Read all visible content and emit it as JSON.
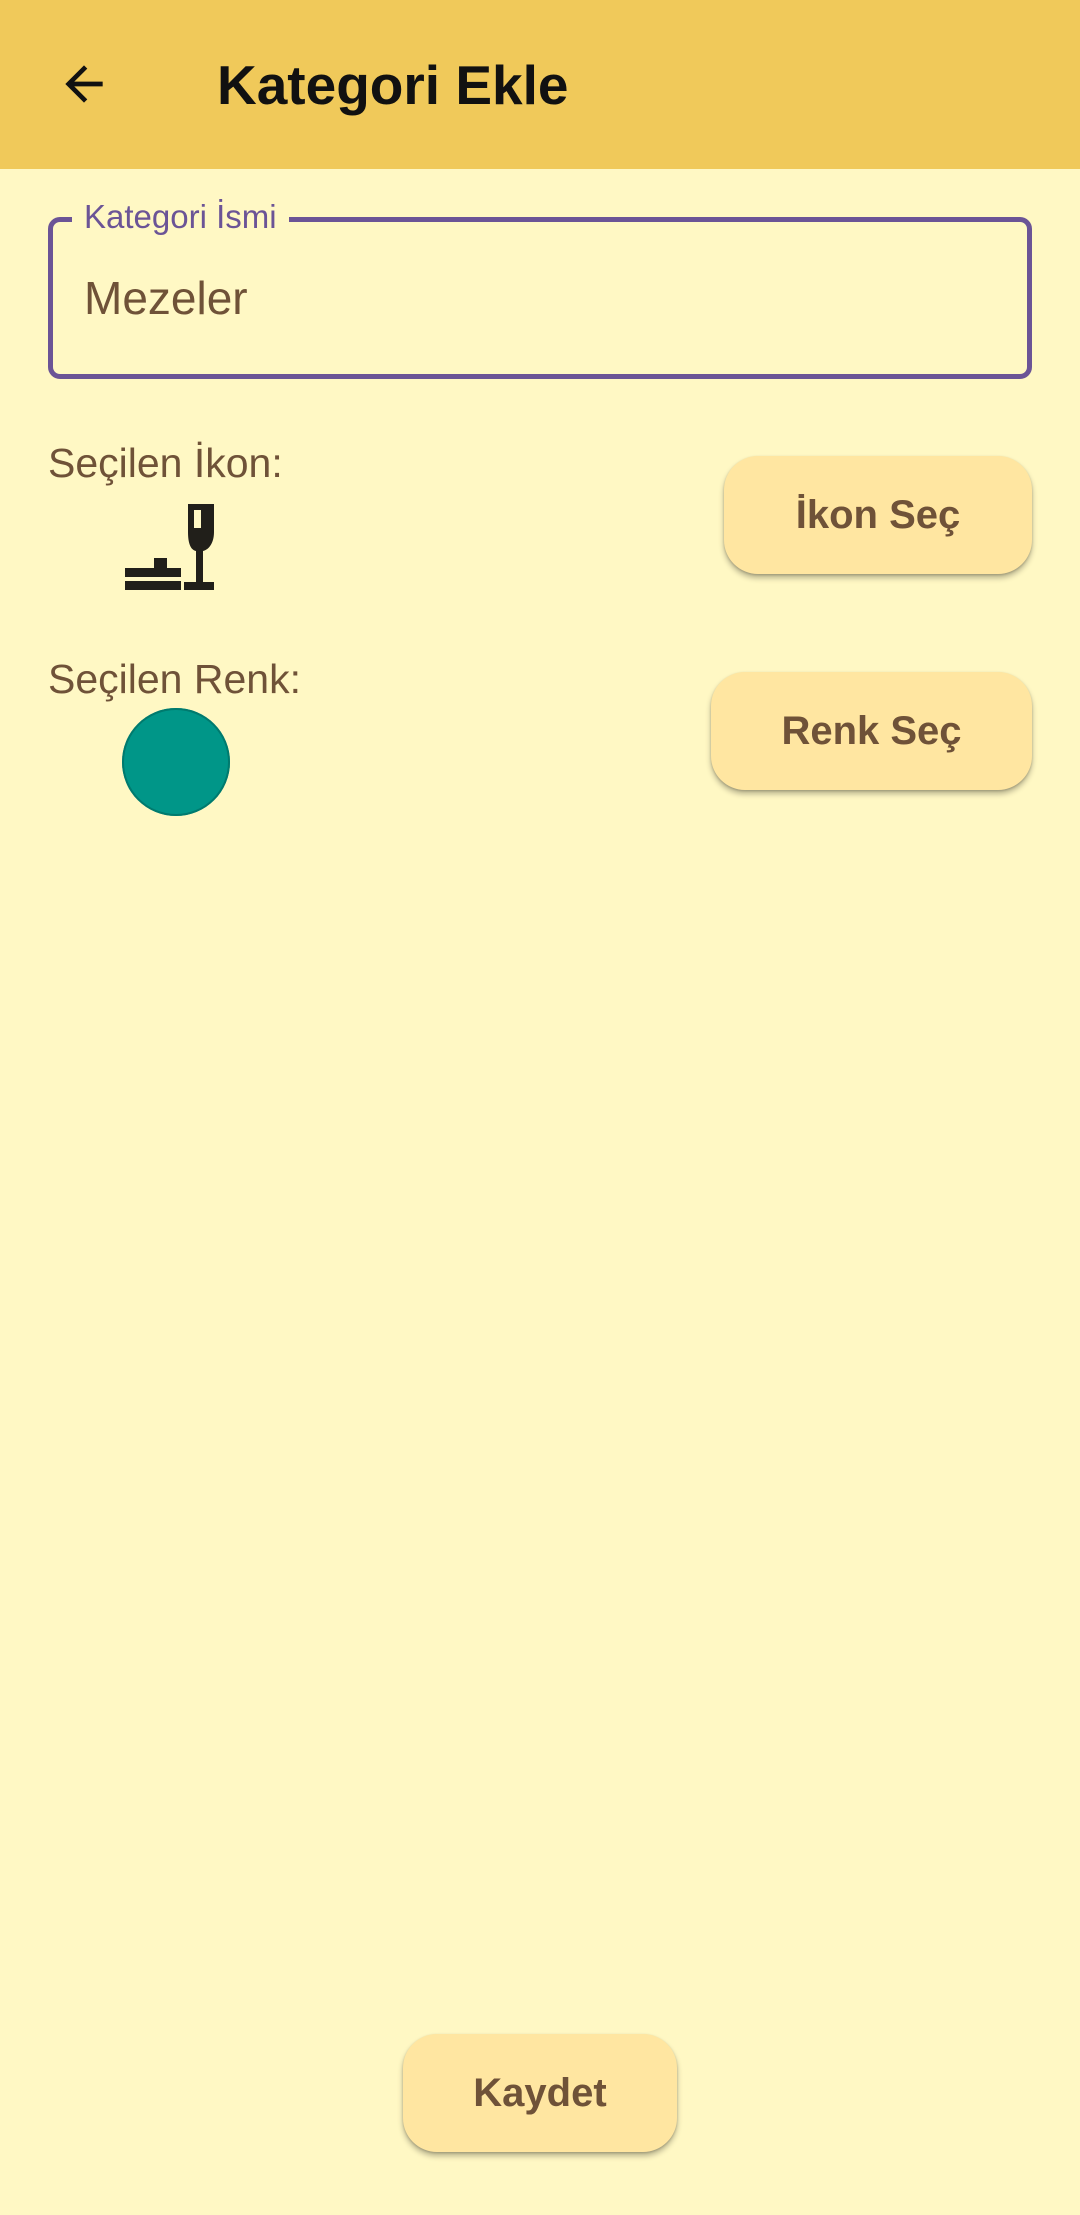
{
  "app_bar": {
    "title": "Kategori Ekle",
    "back_icon": "arrow-left-icon",
    "background_color": "#F0C95A"
  },
  "form": {
    "name_field": {
      "label": "Kategori İsmi",
      "value": "Mezeler"
    },
    "icon_row": {
      "label": "Seçilen İkon:",
      "selected_icon": "dinner-dining-icon",
      "button_label": "İkon Seç"
    },
    "color_row": {
      "label": "Seçilen Renk:",
      "selected_color": "#009688",
      "button_label": "Renk Seç"
    }
  },
  "footer": {
    "save_label": "Kaydet"
  },
  "theme": {
    "background": "#FFF8C4",
    "accent": "#6B5496",
    "button_background": "#FFE6A1",
    "text_color": "#6F5238"
  }
}
